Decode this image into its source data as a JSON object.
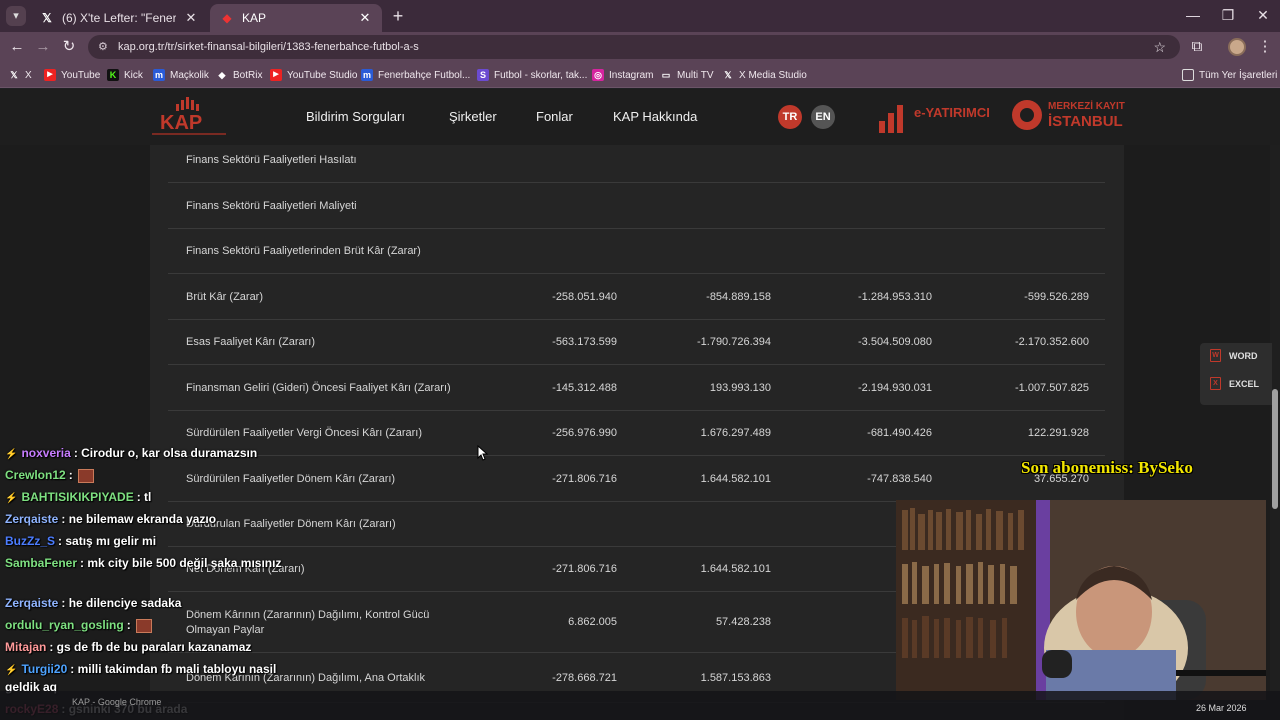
{
  "browser": {
    "tabs": [
      {
        "title": "(6) X'te Lefter: \"Fenerbahçe'nin",
        "icon": "x-icon",
        "active": false
      },
      {
        "title": "KAP",
        "icon": "kap-favicon",
        "active": true
      }
    ],
    "url": "kap.org.tr/tr/sirket-finansal-bilgileri/1383-fenerbahce-futbol-a-s",
    "bookmarks": [
      {
        "label": "X",
        "icon": "x-icon"
      },
      {
        "label": "YouTube",
        "icon": "youtube-icon"
      },
      {
        "label": "Kick",
        "icon": "kick-icon"
      },
      {
        "label": "Maçkolik",
        "icon": "mackolik-icon"
      },
      {
        "label": "BotRix",
        "icon": "botrix-icon"
      },
      {
        "label": "YouTube Studio",
        "icon": "youtube-icon"
      },
      {
        "label": "Fenerbahçe Futbol...",
        "icon": "mackolik-icon"
      },
      {
        "label": "Futbol - skorlar, tak...",
        "icon": "flashscore-icon"
      },
      {
        "label": "Instagram",
        "icon": "instagram-icon"
      },
      {
        "label": "Multi TV",
        "icon": "tv-icon"
      },
      {
        "label": "X Media Studio",
        "icon": "x-icon"
      }
    ],
    "all_bookmarks": "Tüm Yer İşaretleri"
  },
  "site": {
    "nav": [
      "Bildirim Sorguları",
      "Şirketler",
      "Fonlar",
      "KAP Hakkında"
    ],
    "lang": [
      "TR",
      "EN"
    ],
    "partner1": "e-YATIRIMCI",
    "partner2_line1": "MERKEZİ KAYIT",
    "partner2_line2": "İSTANBUL"
  },
  "table": {
    "rows": [
      {
        "label": "Finans Sektörü Faaliyetleri Hasılatı",
        "values": [
          "",
          "",
          "",
          ""
        ]
      },
      {
        "label": "Finans Sektörü Faaliyetleri Maliyeti",
        "values": [
          "",
          "",
          "",
          ""
        ]
      },
      {
        "label": "Finans Sektörü Faaliyetlerinden Brüt Kâr (Zarar)",
        "values": [
          "",
          "",
          "",
          ""
        ]
      },
      {
        "label": "Brüt Kâr (Zarar)",
        "values": [
          "-258.051.940",
          "-854.889.158",
          "-1.284.953.310",
          "-599.526.289"
        ]
      },
      {
        "label": "Esas Faaliyet Kârı (Zararı)",
        "values": [
          "-563.173.599",
          "-1.790.726.394",
          "-3.504.509.080",
          "-2.170.352.600"
        ]
      },
      {
        "label": "Finansman Geliri (Gideri) Öncesi Faaliyet Kârı (Zararı)",
        "values": [
          "-145.312.488",
          "193.993.130",
          "-2.194.930.031",
          "-1.007.507.825"
        ]
      },
      {
        "label": "Sürdürülen Faaliyetler Vergi Öncesi Kârı (Zararı)",
        "values": [
          "-256.976.990",
          "1.676.297.489",
          "-681.490.426",
          "122.291.928"
        ]
      },
      {
        "label": "Sürdürülen Faaliyetler Dönem Kârı (Zararı)",
        "values": [
          "-271.806.716",
          "1.644.582.101",
          "-747.838.540",
          "37.655.270"
        ]
      },
      {
        "label": "Durdurulan Faaliyetler Dönem Kârı (Zararı)",
        "values": [
          "",
          "",
          "",
          ""
        ]
      },
      {
        "label": "Net Dönem Kârı (Zararı)",
        "values": [
          "-271.806.716",
          "1.644.582.101",
          "-747.8",
          ""
        ]
      },
      {
        "label": "Dönem Kârının (Zararının) Dağılımı, Kontrol Gücü Olmayan Paylar",
        "values": [
          "6.862.005",
          "57.428.238",
          "16.7",
          ""
        ]
      },
      {
        "label": "Dönem Kârının (Zararının) Dağılımı, Ana Ortaklık",
        "values": [
          "-278.668.721",
          "1.587.153.863",
          "-764.",
          ""
        ]
      }
    ]
  },
  "export": {
    "word": "WORD",
    "excel": "EXCEL"
  },
  "chat": [
    {
      "user": "noxveria",
      "text": ": Cirodur o, kar olsa duramazsın",
      "color": "#c77dff",
      "badge": true
    },
    {
      "user": "Crewlon12",
      "text": ":",
      "color": "#7ee081",
      "emoji": true
    },
    {
      "user": "BAHTISIKIKPIYADE",
      "text": ": tl",
      "color": "#7ee081",
      "badge": true
    },
    {
      "user": "Zerqaiste",
      "text": ": ne bilemaw ekranda yazıo",
      "color": "#8fb4ff"
    },
    {
      "user": "BuzZz_S",
      "text": ": satış mı gelir mi",
      "color": "#4c7dff"
    },
    {
      "user": "SambaFener",
      "text": ": mk city bile 500 değil şaka mısınız",
      "color": "#7ee081"
    },
    {
      "user": "Zerqaiste",
      "text": ": he dilenciye sadaka",
      "color": "#8fb4ff"
    },
    {
      "user": "ordulu_ryan_gosling",
      "text": ":",
      "color": "#7ee081",
      "emoji": true
    },
    {
      "user": "Mitajan",
      "text": ": gs de fb de bu paraları kazanamaz",
      "color": "#ff9a9a"
    },
    {
      "user": "Turgii20",
      "text": ": milli takimdan fb mali tabloyu nasil",
      "color": "#4ea3ff",
      "badge": true
    },
    {
      "user": "",
      "text": "geldik aq",
      "color": "#ffffff"
    },
    {
      "user": "rockyE28",
      "text": ": gsninki 370 bu arada",
      "color": "#ff5c8a"
    }
  ],
  "overlay": {
    "subscriber": "Son abonemiss: BySeko"
  },
  "taskbar": {
    "window_title": "KAP - Google Chrome",
    "date": "26 Mar 2026"
  },
  "colors": {
    "tabstrip": "#3b2a3a",
    "toolbar": "#5a4356",
    "page_bg": "#1c1c1c",
    "panel_bg": "#252525",
    "overlay_text": "#f2e600"
  }
}
